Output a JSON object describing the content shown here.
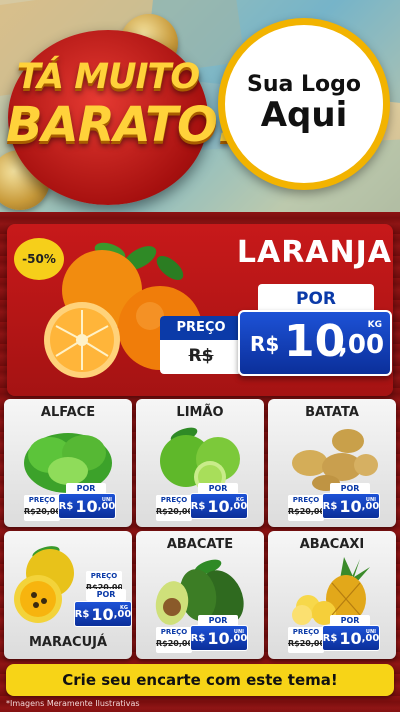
{
  "header": {
    "headline_line1": "TÁ MUITO",
    "headline_line2": "BARATO!",
    "logo_line1": "Sua Logo",
    "logo_line2": "Aqui"
  },
  "hero": {
    "discount": "-50%",
    "name": "LARANJA",
    "old_label": "PREÇO",
    "old_price": "R$ 20,00",
    "new_label": "POR",
    "currency": "R$",
    "price_int": "10",
    "price_cents": ",00",
    "unit": "KG"
  },
  "products": [
    {
      "name": "ALFACE",
      "old_label": "PREÇO",
      "old_price": "R$20,00",
      "new_label": "POR",
      "currency": "R$",
      "price_int": "10",
      "price_cents": ",00",
      "unit": "UNI"
    },
    {
      "name": "LIMÃO",
      "old_label": "PREÇO",
      "old_price": "R$20,00",
      "new_label": "POR",
      "currency": "R$",
      "price_int": "10",
      "price_cents": ",00",
      "unit": "KG"
    },
    {
      "name": "BATATA",
      "old_label": "PREÇO",
      "old_price": "R$20,00",
      "new_label": "POR",
      "currency": "R$",
      "price_int": "10",
      "price_cents": ",00",
      "unit": "UNI"
    },
    {
      "name": "MARACUJÁ",
      "old_label": "PREÇO",
      "old_price": "R$20,00",
      "new_label": "POR",
      "currency": "R$",
      "price_int": "10",
      "price_cents": ",00",
      "unit": "KG"
    },
    {
      "name": "ABACATE",
      "old_label": "PREÇO",
      "old_price": "R$20,00",
      "new_label": "POR",
      "currency": "R$",
      "price_int": "10",
      "price_cents": ",00",
      "unit": "UNI"
    },
    {
      "name": "ABACAXI",
      "old_label": "PREÇO",
      "old_price": "R$20,00",
      "new_label": "POR",
      "currency": "R$",
      "price_int": "10",
      "price_cents": ",00",
      "unit": "UNI"
    }
  ],
  "footer": {
    "cta": "Crie seu encarte com este tema!",
    "disclaimer": "*Imagens Meramente Ilustrativas"
  },
  "colors": {
    "brand_red": "#c7191a",
    "price_blue": "#0b3aa8",
    "accent_yellow": "#f7d417",
    "logo_ring": "#f2b300"
  }
}
